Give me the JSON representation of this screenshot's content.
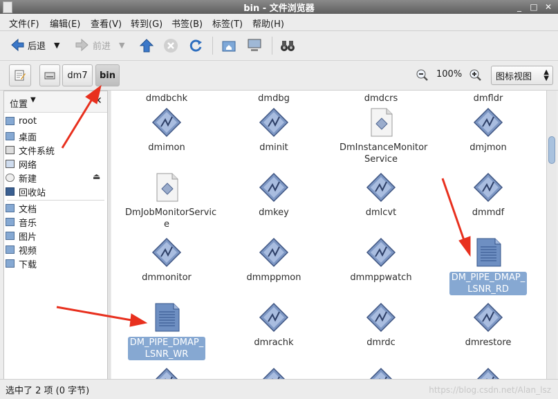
{
  "window": {
    "title": "bin - 文件浏览器"
  },
  "menu": [
    "文件(F)",
    "编辑(E)",
    "查看(V)",
    "转到(G)",
    "书签(B)",
    "标签(T)",
    "帮助(H)"
  ],
  "toolbar": {
    "back": "后退",
    "forward": "前进"
  },
  "path_buttons": [
    "dm7",
    "bin"
  ],
  "zoom": "100%",
  "view_mode": "图标视图",
  "sidebar": {
    "header": "位置",
    "places": [
      "root",
      "桌面",
      "文件系统",
      "网络",
      "新建",
      "回收站"
    ],
    "bookmarks": [
      "文档",
      "音乐",
      "图片",
      "视频",
      "下载"
    ]
  },
  "files": [
    {
      "name": "dmdbchk",
      "partial": true
    },
    {
      "name": "dmdbg",
      "partial": true
    },
    {
      "name": "dmdcrs",
      "partial": true
    },
    {
      "name": "dmfldr",
      "partial": true
    },
    {
      "name": "dmimon",
      "type": "exec"
    },
    {
      "name": "dminit",
      "type": "exec"
    },
    {
      "name": "DmInstanceMonitorService",
      "display": "DmInstanceMonitor\nService",
      "type": "script"
    },
    {
      "name": "dmjmon",
      "type": "exec"
    },
    {
      "name": "DmJobMonitorService",
      "display": "DmJobMonitorServic\ne",
      "type": "script"
    },
    {
      "name": "dmkey",
      "type": "exec"
    },
    {
      "name": "dmlcvt",
      "type": "exec"
    },
    {
      "name": "dmmdf",
      "type": "exec"
    },
    {
      "name": "dmmonitor",
      "type": "exec"
    },
    {
      "name": "dmmppmon",
      "type": "exec"
    },
    {
      "name": "dmmppwatch",
      "type": "exec"
    },
    {
      "name": "DM_PIPE_DMAP_LSNR_RD",
      "display": "DM_PIPE_DMAP_\nLSNR_RD",
      "type": "pipe",
      "selected": true
    },
    {
      "name": "DM_PIPE_DMAP_LSNR_WR",
      "display": "DM_PIPE_DMAP_\nLSNR_WR",
      "type": "pipe",
      "selected": true
    },
    {
      "name": "dmrachk",
      "type": "exec"
    },
    {
      "name": "dmrdc",
      "type": "exec"
    },
    {
      "name": "dmrestore",
      "type": "exec"
    }
  ],
  "status": "选中了 2 项 (0 字节)",
  "watermark": "https://blog.csdn.net/Alan_lsz"
}
